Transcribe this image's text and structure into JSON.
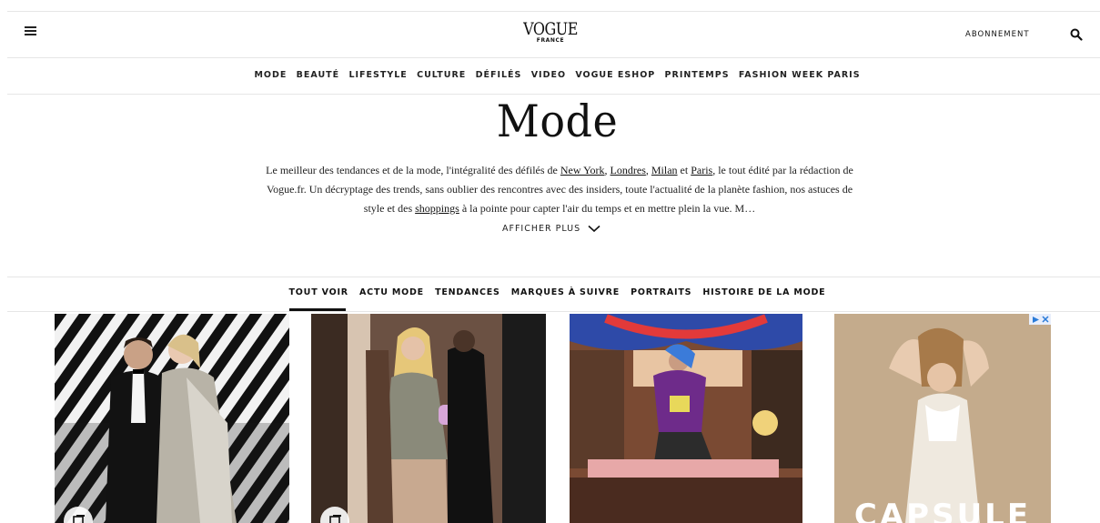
{
  "header": {
    "brand": "VOGUE",
    "edition": "FRANCE",
    "subscribe_label": "ABONNEMENT"
  },
  "main_nav": [
    "MODE",
    "BEAUTÉ",
    "LIFESTYLE",
    "CULTURE",
    "DÉFILÉS",
    "VIDEO",
    "VOGUE ESHOP",
    "PRINTEMPS",
    "FASHION WEEK PARIS"
  ],
  "hero": {
    "title": "Mode",
    "intro_1": "Le meilleur des tendances et de la mode, l'intégralité des défilés de ",
    "link_ny": "New York",
    "sep_1": ", ",
    "link_london": "Londres",
    "sep_2": ", ",
    "link_milan": "Milan",
    "sep_3": " et ",
    "link_paris": "Paris",
    "intro_2": ", le tout édité par la rédaction de Vogue.fr. Un décryptage des trends, sans oublier des rencontres avec des insiders, toute l'actualité de la planète fashion, nos astuces de style et des ",
    "link_shoppings": "shoppings",
    "intro_3": " à la pointe pour capter l'air du temps et en mettre plein la vue.  M…",
    "show_more_label": "AFFICHER PLUS"
  },
  "sub_nav": {
    "active_index": 0,
    "items": [
      "TOUT VOIR",
      "ACTU MODE",
      "TENDANCES",
      "MARQUES À SUIVRE",
      "PORTRAITS",
      "HISTOIRE DE LA MODE"
    ]
  },
  "ad": {
    "text": "CAPSULE"
  },
  "icons": {
    "menu": "menu-icon",
    "search": "search-icon",
    "chevron": "chevron-down-icon",
    "gallery": "gallery-icon",
    "ad_choices": "ad-choices-icon",
    "ad_close": "close-icon"
  }
}
